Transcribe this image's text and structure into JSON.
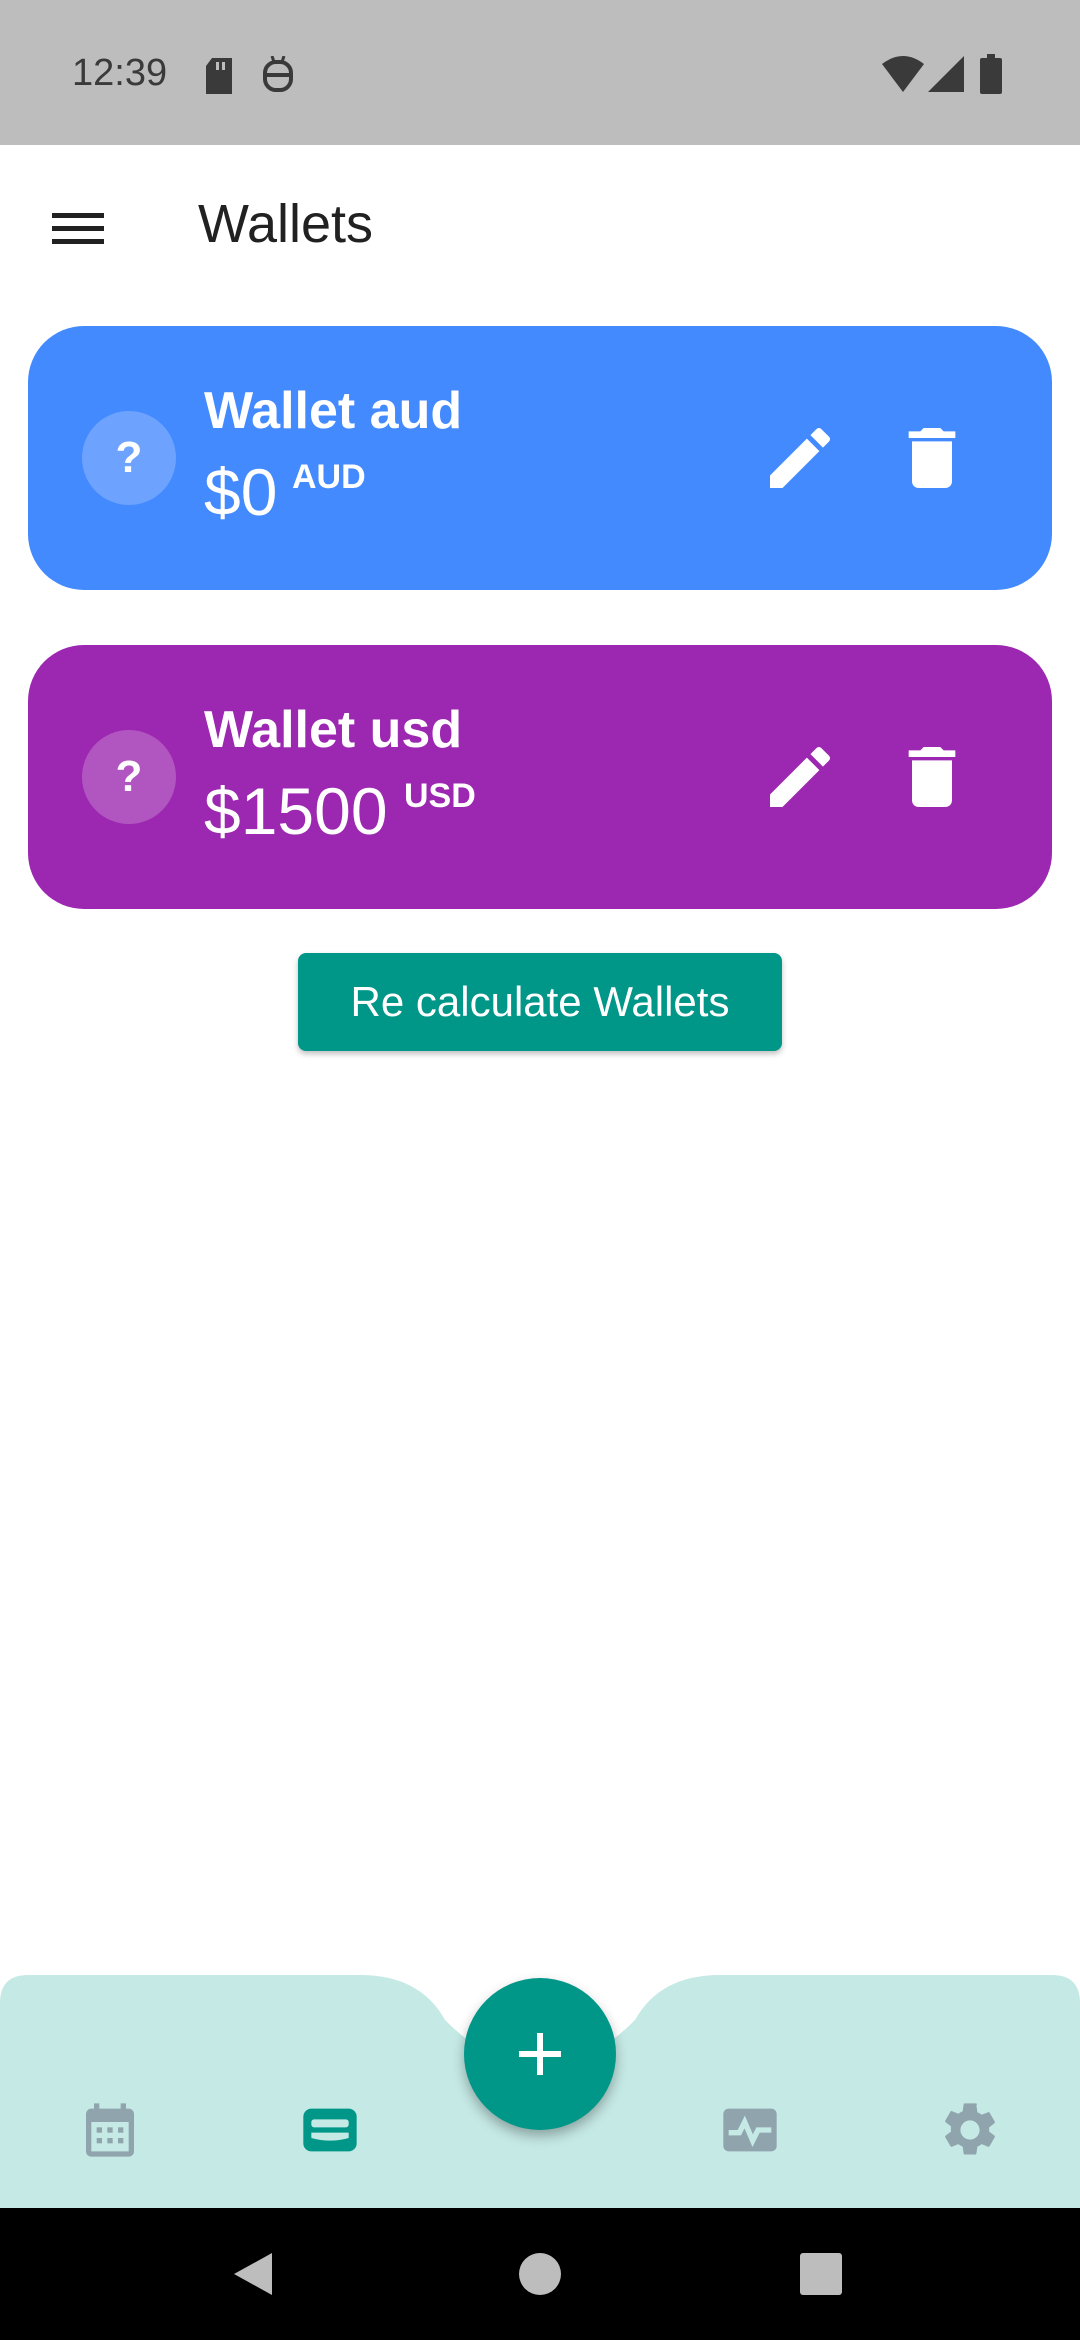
{
  "status_bar": {
    "time": "12:39",
    "icons": [
      "sd-card-icon",
      "vpn-robot-icon",
      "wifi-icon",
      "signal-icon",
      "battery-icon"
    ]
  },
  "app_bar": {
    "title": "Wallets",
    "menu_icon": "hamburger-menu-icon"
  },
  "wallets": [
    {
      "name": "Wallet aud",
      "amount": "$0",
      "currency": "AUD",
      "avatar": "?",
      "color": "#448aff",
      "edit_icon": "pencil-icon",
      "delete_icon": "trash-icon"
    },
    {
      "name": "Wallet usd",
      "amount": "$1500",
      "currency": "USD",
      "avatar": "?",
      "color": "#9c27b0",
      "edit_icon": "pencil-icon",
      "delete_icon": "trash-icon"
    }
  ],
  "recalculate_button": "Re calculate Wallets",
  "fab": {
    "icon": "plus-icon",
    "color": "#009688"
  },
  "bottom_nav": {
    "background": "#c5e9e5",
    "active_color": "#009688",
    "inactive_color": "#90a4ae",
    "items": [
      {
        "icon": "calendar-icon",
        "active": false
      },
      {
        "icon": "wallet-icon",
        "active": true
      },
      {
        "icon": "activity-chart-icon",
        "active": false
      },
      {
        "icon": "gear-icon",
        "active": false
      }
    ]
  },
  "system_nav": [
    "back-icon",
    "home-icon",
    "recents-icon"
  ]
}
